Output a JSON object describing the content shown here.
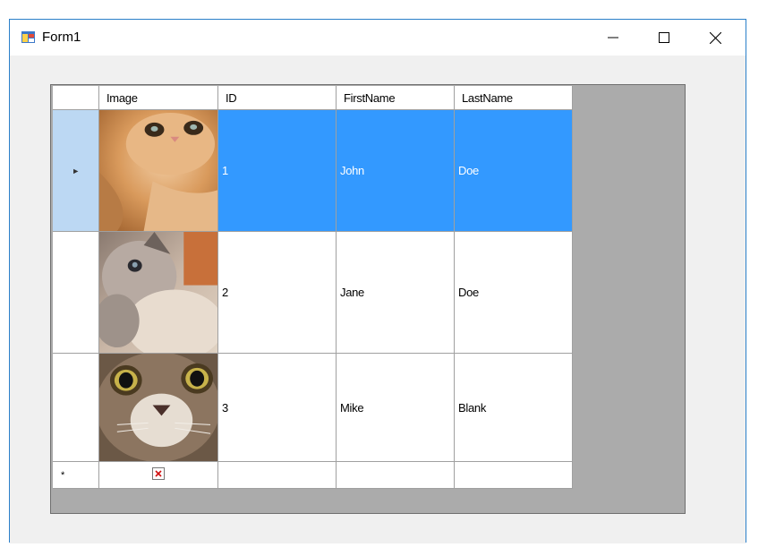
{
  "window": {
    "title": "Form1"
  },
  "grid": {
    "columns": [
      "Image",
      "ID",
      "FirstName",
      "LastName"
    ],
    "rows": [
      {
        "image": "orange-kitten-photo",
        "id": "1",
        "first_name": "John",
        "last_name": "Doe",
        "selected": true
      },
      {
        "image": "grey-white-kitten-photo",
        "id": "2",
        "first_name": "Jane",
        "last_name": "Doe",
        "selected": false
      },
      {
        "image": "wide-eyed-cat-photo",
        "id": "3",
        "first_name": "Mike",
        "last_name": "Blank",
        "selected": false
      }
    ],
    "new_row_marker": "*",
    "current_row_marker": "►",
    "broken_image_icon": "red-x-icon"
  },
  "colors": {
    "selection": "#3399ff",
    "selection_header": "#bcd8f3",
    "grid_background": "#ababab",
    "window_border": "#2a7fc9"
  }
}
